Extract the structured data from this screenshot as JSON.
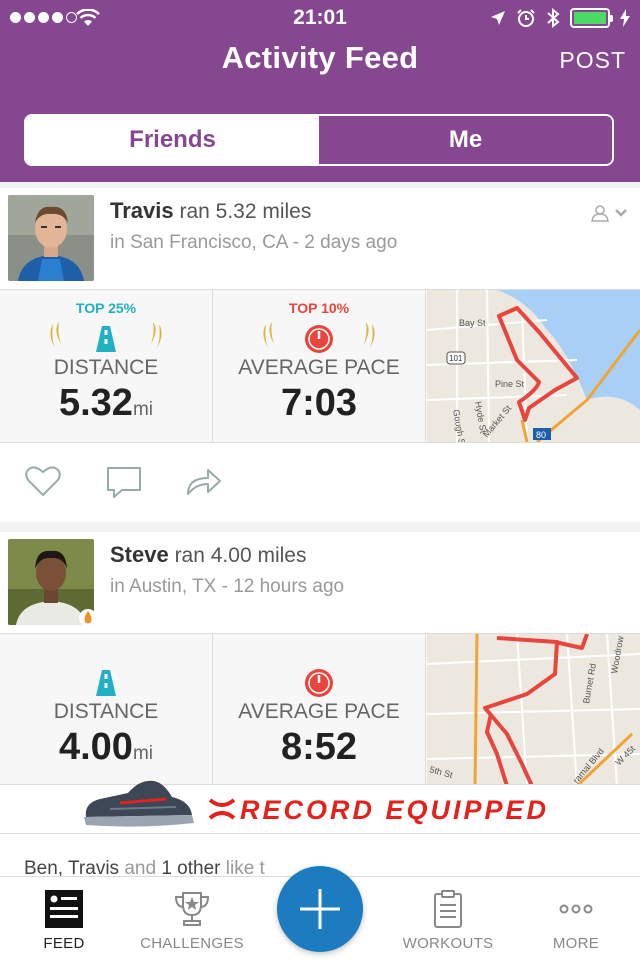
{
  "status": {
    "time": "21:01"
  },
  "header": {
    "title": "Activity Feed",
    "post_label": "POST",
    "tabs": [
      {
        "label": "Friends",
        "active": true
      },
      {
        "label": "Me",
        "active": false
      }
    ],
    "colors": {
      "brand": "#85478f",
      "accent_teal": "#22b0c4",
      "accent_red": "#e8453c",
      "fab": "#1d7bbf"
    }
  },
  "feed": [
    {
      "name": "Travis",
      "action": "ran 5.32 miles",
      "location": "in San Francisco, CA - 2 days ago",
      "stats": [
        {
          "rank": "TOP 25%",
          "icon": "road-icon",
          "label": "DISTANCE",
          "value": "5.32",
          "unit": "mi"
        },
        {
          "rank": "TOP 10%",
          "icon": "speedometer-icon",
          "label": "AVERAGE PACE",
          "value": "7:03",
          "unit": ""
        }
      ],
      "map_labels": [
        "Bay St",
        "101",
        "Pine St",
        "Hyde St",
        "Gough St",
        "Market St",
        "80"
      ]
    },
    {
      "name": "Steve",
      "action": "ran 4.00 miles",
      "location": "in Austin, TX - 12 hours ago",
      "stats": [
        {
          "rank": "",
          "icon": "road-icon",
          "label": "DISTANCE",
          "value": "4.00",
          "unit": "mi"
        },
        {
          "rank": "",
          "icon": "speedometer-icon",
          "label": "AVERAGE PACE",
          "value": "8:52",
          "unit": ""
        }
      ],
      "map_labels": [
        "Burnet Rd",
        "Woodrow",
        "W 45t",
        "ramal Blvd",
        "5th St"
      ],
      "ad_text": "RECORD EQUIPPED",
      "likes": {
        "names": "Ben, Travis",
        "and": "and",
        "count": "1 other",
        "tail": "like t"
      }
    }
  ],
  "tabbar": [
    {
      "label": "FEED",
      "icon": "feed-icon",
      "active": true
    },
    {
      "label": "CHALLENGES",
      "icon": "trophy-icon",
      "active": false
    },
    {
      "label": "WORKOUTS",
      "icon": "clipboard-icon",
      "active": false
    },
    {
      "label": "MORE",
      "icon": "more-dots-icon",
      "active": false
    }
  ]
}
